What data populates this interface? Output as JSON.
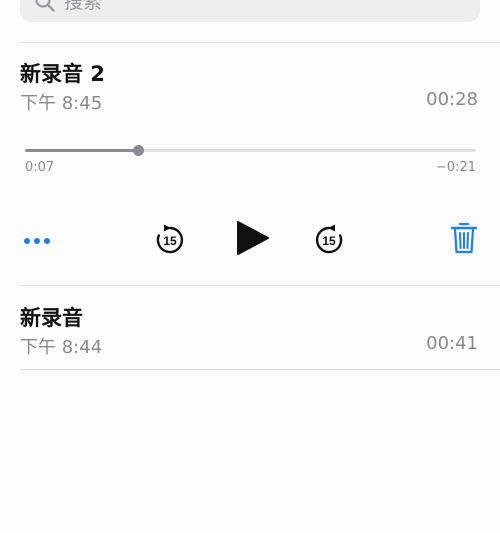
{
  "search": {
    "placeholder": "搜索"
  },
  "recordings": [
    {
      "title": "新录音 2",
      "time": "下午 8:45",
      "duration": "00:28",
      "expanded": true,
      "player": {
        "elapsed": "0:07",
        "remaining": "−0:21",
        "progress": 0.25,
        "skip_seconds": "15"
      }
    },
    {
      "title": "新录音",
      "time": "下午 8:44",
      "duration": "00:41",
      "expanded": false
    }
  ],
  "colors": {
    "accent": "#1a7ff0",
    "text_primary": "#111111",
    "text_secondary": "#8a8a8e",
    "divider": "#e4e4e6"
  },
  "icons": {
    "search": "search-icon",
    "more": "more-dots-icon",
    "skip_back": "skip-back-15-icon",
    "play": "play-icon",
    "skip_forward": "skip-forward-15-icon",
    "delete": "trash-icon"
  }
}
